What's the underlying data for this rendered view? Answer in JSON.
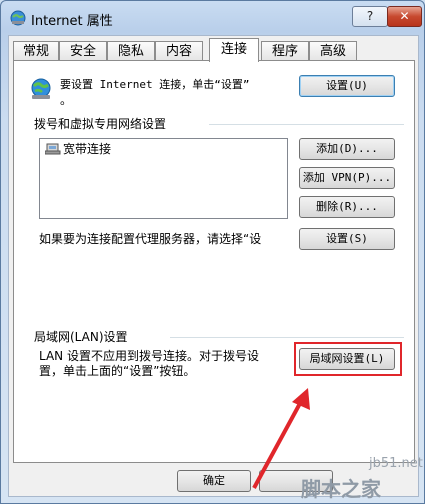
{
  "window": {
    "title": "Internet 属性",
    "help_label": "?",
    "close_label": "✕"
  },
  "tabs": [
    {
      "label": "常规",
      "active": false
    },
    {
      "label": "安全",
      "active": false
    },
    {
      "label": "隐私",
      "active": false
    },
    {
      "label": "内容",
      "active": false
    },
    {
      "label": "连接",
      "active": true
    },
    {
      "label": "程序",
      "active": false
    },
    {
      "label": "高级",
      "active": false
    }
  ],
  "setup": {
    "text_line1": "要设置 Internet 连接，单击“设置”",
    "text_line2": "。",
    "button": "设置(U)"
  },
  "dialup": {
    "heading": "拨号和虚拟专用网络设置",
    "connections": [
      "宽带连接"
    ],
    "add_button": "添加(D)...",
    "add_vpn_button": "添加 VPN(P)...",
    "delete_button": "删除(R)...",
    "proxy_text": "如果要为连接配置代理服务器，请选择“设",
    "settings_button": "设置(S)"
  },
  "lan": {
    "heading": "局域网(LAN)设置",
    "text_line1": "LAN 设置不应用到拨号连接。对于拨号设",
    "text_line2": "置，单击上面的“设置”按钮。",
    "button": "局域网设置(L)"
  },
  "footer": {
    "ok_button": "确定"
  },
  "watermark": {
    "line1": "jb51.net",
    "line2": "脚本之家"
  },
  "colors": {
    "highlight": "#e0262b",
    "accent": "#3c7fb1"
  }
}
